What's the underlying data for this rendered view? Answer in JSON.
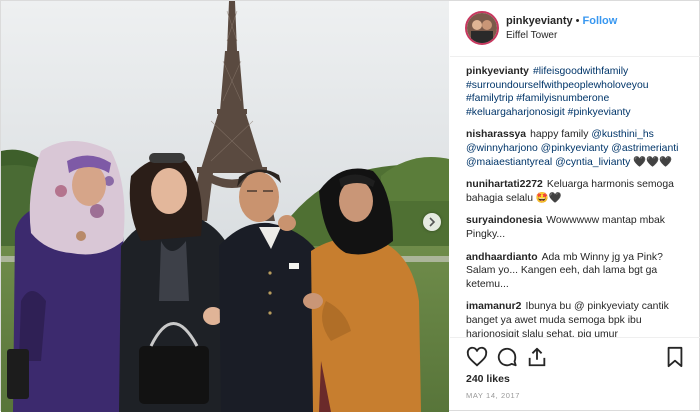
{
  "post": {
    "username": "pinkyevianty",
    "separator": "•",
    "follow_label": "Follow",
    "location": "Eiffel Tower"
  },
  "caption": {
    "username": "pinkyevianty",
    "tags": [
      "#lifeisgoodwithfamily",
      "#surroundourselfwithpeoplewholoveyou",
      "#familytrip",
      "#familyisnumberone",
      "#keluargaharjonosigit",
      "#pinkyevianty"
    ]
  },
  "comments": [
    {
      "username": "nisharassya",
      "text": "happy family",
      "mentions": [
        "@kusthini_hs",
        "@winnyharjono",
        "@pinkyevianty",
        "@astrimerianti",
        "@maiaestiantyreal",
        "@cyntia_livianty"
      ],
      "tail": "🖤🖤🖤"
    },
    {
      "username": "nunihartati2272",
      "text": "Keluarga harmonis semoga bahagia selalu 🤩🖤"
    },
    {
      "username": "suryaindonesia",
      "text": "Wowwwww mantap mbak Pingky..."
    },
    {
      "username": "andhaardianto",
      "text": "Ada mb Winny jg ya Pink? Salam yo... Kangen eeh, dah lama bgt ga ketemu..."
    },
    {
      "username": "imamanur2",
      "text": "Ibunya bu @ pinkyeviaty cantik banget ya awet muda semoga bpk ibu harjonosigit slalu sehat, pjg umur"
    }
  ],
  "actions": {
    "icons": [
      "heart-icon",
      "comment-icon",
      "share-icon",
      "bookmark-icon"
    ],
    "likes": "240 likes",
    "date": "MAY 14, 2017"
  },
  "colors": {
    "link": "#003569",
    "follow": "#3897f0",
    "border": "#dbdbdb",
    "muted": "#999999"
  },
  "photo": {
    "carousel_next_icon": "chevron-right-icon"
  }
}
